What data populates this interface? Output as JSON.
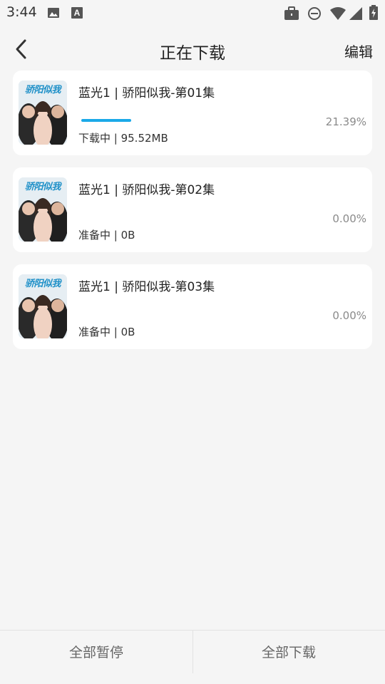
{
  "status_bar": {
    "time": "3:44",
    "icons_left": [
      "image-icon",
      "a-icon"
    ],
    "icons_right": [
      "briefcase-icon",
      "dnd-icon",
      "wifi-icon",
      "signal-icon",
      "battery-icon"
    ]
  },
  "header": {
    "back_icon": "chevron-left-icon",
    "title": "正在下载",
    "edit_label": "编辑"
  },
  "downloads": [
    {
      "title": "蓝光1 | 骄阳似我-第01集",
      "status": "下载中 | 95.52MB",
      "percent_label": "21.39%",
      "progress": 0.2139,
      "thumb_text": "骄阳似我"
    },
    {
      "title": "蓝光1 | 骄阳似我-第02集",
      "status": "准备中 | 0B",
      "percent_label": "0.00%",
      "progress": 0,
      "thumb_text": "骄阳似我"
    },
    {
      "title": "蓝光1 | 骄阳似我-第03集",
      "status": "准备中 | 0B",
      "percent_label": "0.00%",
      "progress": 0,
      "thumb_text": "骄阳似我"
    }
  ],
  "bottom_bar": {
    "pause_all_label": "全部暂停",
    "download_all_label": "全部下载"
  },
  "colors": {
    "accent": "#1ba9e8",
    "background": "#f5f5f5",
    "card": "#ffffff"
  }
}
